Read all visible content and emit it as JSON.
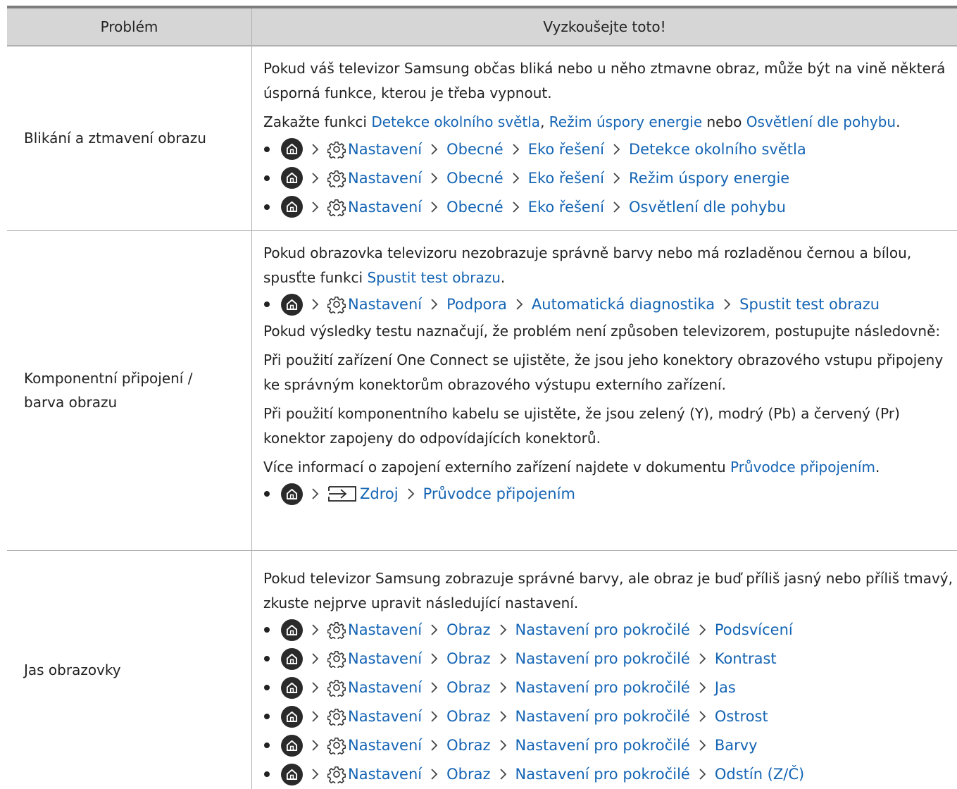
{
  "headers": {
    "problem": "Problém",
    "try": "Vyzkoušejte toto!"
  },
  "row1": {
    "problem": "Blikání a ztmavení obrazu",
    "p1": "Pokud váš televizor Samsung občas bliká nebo u něho ztmavne obraz, může být na vině některá úsporná funkce, kterou je třeba vypnout.",
    "p2_prefix": "Zakažte funkci ",
    "p2_l1": "Detekce okolního světla",
    "p2_sep1": ", ",
    "p2_l2": "Režim úspory energie",
    "p2_sep2": " nebo ",
    "p2_l3": "Osvětlení dle pohybu",
    "p2_end": ".",
    "paths": [
      [
        "Nastavení",
        "Obecné",
        "Eko řešení",
        "Detekce okolního světla"
      ],
      [
        "Nastavení",
        "Obecné",
        "Eko řešení",
        "Režim úspory energie"
      ],
      [
        "Nastavení",
        "Obecné",
        "Eko řešení",
        "Osvětlení dle pohybu"
      ]
    ]
  },
  "row2": {
    "problem_l1": "Komponentní připojení /",
    "problem_l2": "barva obrazu",
    "p1_a": "Pokud obrazovka televizoru nezobrazuje správně barvy nebo má rozladěnou černou a bílou, spusťte funkci ",
    "p1_link": "Spustit test obrazu",
    "p1_end": ".",
    "path1": [
      "Nastavení",
      "Podpora",
      "Automatická diagnostika",
      "Spustit test obrazu"
    ],
    "p2": "Pokud výsledky testu naznačují, že problém není způsoben televizorem, postupujte následovně:",
    "p3": "Při použití zařízení One Connect se ujistěte, že jsou jeho konektory obrazového vstupu připojeny ke správným konektorům obrazového výstupu externího zařízení.",
    "p4": "Při použití komponentního kabelu se ujistěte, že jsou zelený (Y), modrý (Pb) a červený (Pr) konektor zapojeny do odpovídajících konektorů.",
    "p5_a": "Více informací o zapojení externího zařízení najdete v dokumentu ",
    "p5_link": "Průvodce připojením",
    "p5_end": ".",
    "path2": [
      "Zdroj",
      "Průvodce připojením"
    ]
  },
  "row3": {
    "problem": "Jas obrazovky",
    "p1": "Pokud televizor Samsung zobrazuje správné barvy, ale obraz je buď příliš jasný nebo příliš tmavý, zkuste nejprve upravit následující nastavení.",
    "paths": [
      [
        "Nastavení",
        "Obraz",
        "Nastavení pro pokročilé",
        "Podsvícení"
      ],
      [
        "Nastavení",
        "Obraz",
        "Nastavení pro pokročilé",
        "Kontrast"
      ],
      [
        "Nastavení",
        "Obraz",
        "Nastavení pro pokročilé",
        "Jas"
      ],
      [
        "Nastavení",
        "Obraz",
        "Nastavení pro pokročilé",
        "Ostrost"
      ],
      [
        "Nastavení",
        "Obraz",
        "Nastavení pro pokročilé",
        "Barvy"
      ],
      [
        "Nastavení",
        "Obraz",
        "Nastavení pro pokročilé",
        "Odstín (Z/Č)"
      ]
    ]
  },
  "icons": {
    "home": "home-icon",
    "settings": "gear-icon",
    "source": "source-icon",
    "separator": "chevron-right-icon"
  },
  "colors": {
    "link": "#1464b4",
    "header_bg": "#d6d6d6"
  }
}
